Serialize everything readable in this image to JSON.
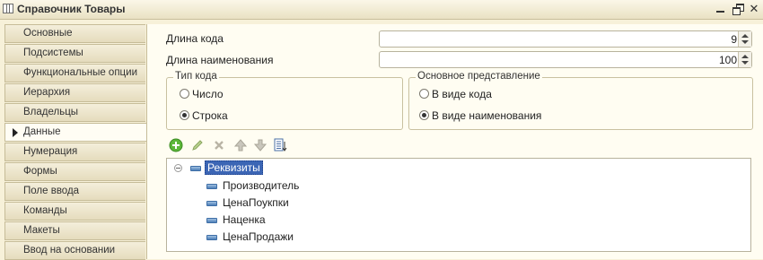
{
  "window": {
    "title": "Справочник Товары"
  },
  "sidebar": {
    "items": [
      {
        "label": "Основные"
      },
      {
        "label": "Подсистемы"
      },
      {
        "label": "Функциональные опции"
      },
      {
        "label": "Иерархия"
      },
      {
        "label": "Владельцы"
      },
      {
        "label": "Данные",
        "active": true
      },
      {
        "label": "Нумерация"
      },
      {
        "label": "Формы"
      },
      {
        "label": "Поле ввода"
      },
      {
        "label": "Команды"
      },
      {
        "label": "Макеты"
      },
      {
        "label": "Ввод на основании"
      }
    ]
  },
  "fields": {
    "code_length": {
      "label": "Длина кода",
      "value": "9"
    },
    "name_length": {
      "label": "Длина наименования",
      "value": "100"
    }
  },
  "code_type": {
    "title": "Тип кода",
    "options": [
      {
        "label": "Число",
        "selected": false
      },
      {
        "label": "Строка",
        "selected": true
      }
    ]
  },
  "main_presentation": {
    "title": "Основное представление",
    "options": [
      {
        "label": "В виде кода",
        "selected": false
      },
      {
        "label": "В виде наименования",
        "selected": true
      }
    ]
  },
  "toolbar": {
    "icons": [
      "add-icon",
      "edit-icon",
      "delete-icon",
      "move-up-icon",
      "move-down-icon",
      "sort-list-icon"
    ]
  },
  "tree": {
    "root": "Реквизиты",
    "children": [
      "Производитель",
      "ЦенаПоукпки",
      "Наценка",
      "ЦенаПродажи"
    ]
  }
}
